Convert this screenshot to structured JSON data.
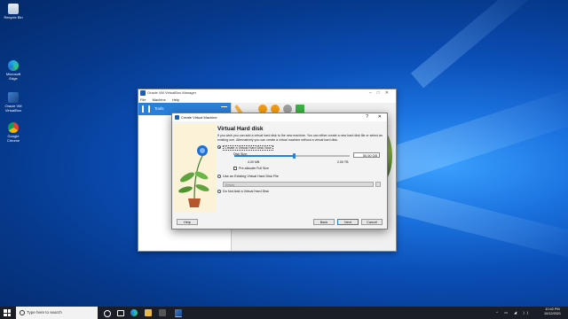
{
  "desktop": {
    "icons": [
      {
        "label": "Recycle Bin",
        "icon": "recycle-bin-icon"
      },
      {
        "label": "Microsoft Edge",
        "icon": "edge-icon"
      },
      {
        "label": "Oracle VM VirtualBox",
        "icon": "virtualbox-icon"
      },
      {
        "label": "Google Chrome",
        "icon": "chrome-icon"
      }
    ]
  },
  "manager": {
    "title": "Oracle VM VirtualBox Manager",
    "menu": [
      "File",
      "Machine",
      "Help"
    ],
    "tools_label": "Tools"
  },
  "dialog": {
    "title": "Create Virtual Machine",
    "help_glyph": "?",
    "close_glyph": "✕",
    "heading": "Virtual Hard disk",
    "intro": "If you wish you can add a virtual hard disk to the new machine. You can either create a new hard disk file or select an existing one. Alternatively you can create a virtual machine without a virtual hard disk.",
    "option_create": "Create a Virtual Hard Disk Now",
    "disk_size_label": "Disk Size:",
    "disk_size_value": "50.00 GB",
    "disk_min": "4.00 MB",
    "disk_max": "2.00 TB",
    "slider_fraction": 0.52,
    "preallocate_label": "Pre-allocate Full Size",
    "option_existing": "Use an Existing Virtual Hard Disk File",
    "existing_value": "Empty",
    "option_none": "Do Not Add a Virtual Hard Disk",
    "buttons": {
      "help": "Help",
      "back": "Back",
      "next": "Next",
      "cancel": "Cancel"
    }
  },
  "taskbar": {
    "search_placeholder": "Type here to search",
    "time": "10:42 PM",
    "date": "10/12/2021"
  },
  "colors": {
    "accent": "#2a7fd8",
    "taskbar": "#1b1e26"
  }
}
